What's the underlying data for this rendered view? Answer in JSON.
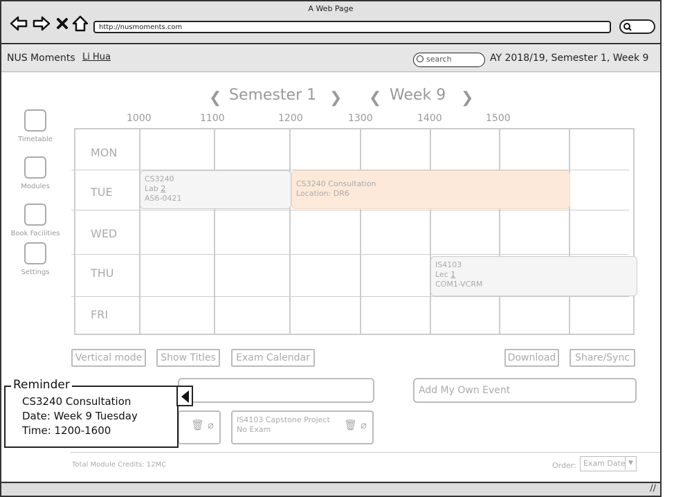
{
  "browser": {
    "title": "A Web Page",
    "url": "http://nusmoments.com"
  },
  "header": {
    "brand": "NUS Moments",
    "user": "Li Hua",
    "search_placeholder": "search",
    "academic_year": "AY 2018/19, Semester 1, Week 9"
  },
  "nav": {
    "semester": "Semester 1",
    "week": "Week 9"
  },
  "sidebar": {
    "items": [
      {
        "label": "Timetable"
      },
      {
        "label": "Modules"
      },
      {
        "label": "Book Facilities"
      },
      {
        "label": "Settings"
      }
    ]
  },
  "timetable": {
    "hours": [
      "1000",
      "1100",
      "1200",
      "1300",
      "1400",
      "1500"
    ],
    "days": [
      "MON",
      "TUE",
      "WED",
      "THU",
      "FRI"
    ],
    "events": {
      "cs3240_lab": {
        "code": "CS3240",
        "type": "Lab",
        "num": "2",
        "venue": "AS6-0421"
      },
      "consultation": {
        "title": "CS3240 Consultation",
        "location": "Location: DR6"
      },
      "is4103_lec": {
        "code": "IS4103",
        "type": "Lec",
        "num": "1",
        "venue": "COM1-VCRM"
      }
    }
  },
  "actions": {
    "vertical_mode": "Vertical mode",
    "show_titles": "Show Titles",
    "exam_calendar": "Exam Calendar",
    "download": "Download",
    "share_sync": "Share/Sync"
  },
  "add_event_placeholder": "Add My Own Event",
  "module_card": {
    "title": "IS4103 Capstone Project",
    "exam": "No Exam"
  },
  "footer": {
    "credits": "Total Module Credits: 12MC",
    "order_label": "Order:",
    "order_value": "Exam Date"
  },
  "reminder": {
    "title": "Reminder",
    "event": "CS3240 Consultation",
    "date": "Date: Week 9 Tuesday",
    "time": "Time: 1200-1600"
  }
}
